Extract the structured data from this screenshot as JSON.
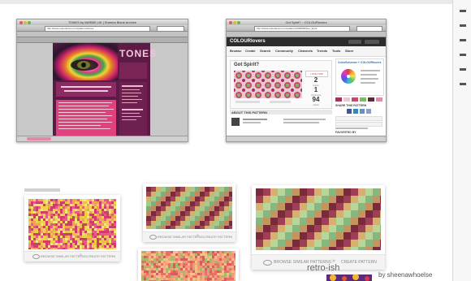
{
  "page": {
    "caption_retro": "retro-ish",
    "caption_by": "by sheenawhoelse"
  },
  "window_left": {
    "title": "TONES by BARBIE.UK | Sheena Blank Archive",
    "url": "http://www.colourlovers.com/patterns/tones",
    "site_banner": "TONES",
    "sidebar_header": "Categories",
    "colors": {
      "page_bg": "#5c1a46",
      "panel": "#8b2a63",
      "accent": "#e7528d"
    }
  },
  "window_right": {
    "title": "Got Spirit? :: COLOURlovers",
    "url": "http://www.colourlovers.com/pattern/1000000/Got_Spirit",
    "logo": "COLOURlovers",
    "nav": [
      "Browse",
      "Create",
      "Search",
      "Community",
      "Channels",
      "Trends",
      "Tools",
      "Store"
    ],
    "pattern_title": "Got Spirit?",
    "love_label": "LOVE THIS",
    "stats": [
      {
        "value": "2",
        "label": "loves"
      },
      {
        "value": "1",
        "label": "comment"
      },
      {
        "value": "94",
        "label": "views"
      }
    ],
    "about_heading": "ABOUT THIS PATTERN",
    "ad_logo": "ColorSchemer + COLOURlovers",
    "share_heading": "SHARE THIS PATTERN",
    "favorites_heading": "FAVORITED BY"
  },
  "cards": [
    {
      "browse": "BROWSE SIMILAR PATTERNS",
      "create": "CREATE PATTERN"
    },
    {
      "browse": "BROWSE SIMILAR PATTERNS",
      "create": "CREATE PATTERN"
    },
    {
      "browse": "BROWSE SIMILAR PATTERNS",
      "create": "CREATE PATTERN"
    }
  ]
}
